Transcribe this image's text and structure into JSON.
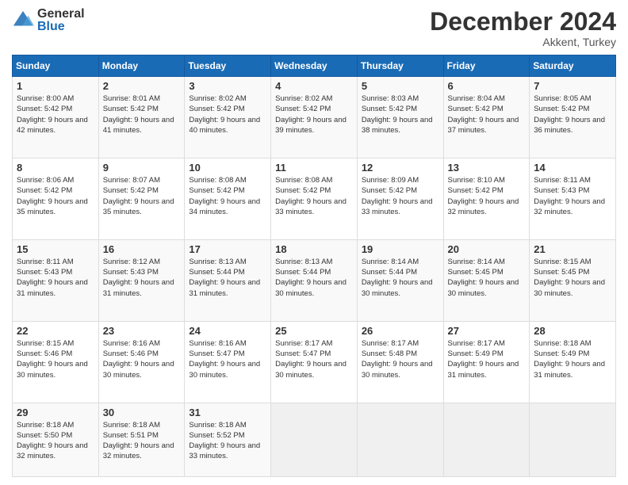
{
  "logo": {
    "general": "General",
    "blue": "Blue"
  },
  "title": "December 2024",
  "location": "Akkent, Turkey",
  "days_header": [
    "Sunday",
    "Monday",
    "Tuesday",
    "Wednesday",
    "Thursday",
    "Friday",
    "Saturday"
  ],
  "weeks": [
    [
      {
        "day": "1",
        "sunrise": "Sunrise: 8:00 AM",
        "sunset": "Sunset: 5:42 PM",
        "daylight": "Daylight: 9 hours and 42 minutes."
      },
      {
        "day": "2",
        "sunrise": "Sunrise: 8:01 AM",
        "sunset": "Sunset: 5:42 PM",
        "daylight": "Daylight: 9 hours and 41 minutes."
      },
      {
        "day": "3",
        "sunrise": "Sunrise: 8:02 AM",
        "sunset": "Sunset: 5:42 PM",
        "daylight": "Daylight: 9 hours and 40 minutes."
      },
      {
        "day": "4",
        "sunrise": "Sunrise: 8:02 AM",
        "sunset": "Sunset: 5:42 PM",
        "daylight": "Daylight: 9 hours and 39 minutes."
      },
      {
        "day": "5",
        "sunrise": "Sunrise: 8:03 AM",
        "sunset": "Sunset: 5:42 PM",
        "daylight": "Daylight: 9 hours and 38 minutes."
      },
      {
        "day": "6",
        "sunrise": "Sunrise: 8:04 AM",
        "sunset": "Sunset: 5:42 PM",
        "daylight": "Daylight: 9 hours and 37 minutes."
      },
      {
        "day": "7",
        "sunrise": "Sunrise: 8:05 AM",
        "sunset": "Sunset: 5:42 PM",
        "daylight": "Daylight: 9 hours and 36 minutes."
      }
    ],
    [
      {
        "day": "8",
        "sunrise": "Sunrise: 8:06 AM",
        "sunset": "Sunset: 5:42 PM",
        "daylight": "Daylight: 9 hours and 35 minutes."
      },
      {
        "day": "9",
        "sunrise": "Sunrise: 8:07 AM",
        "sunset": "Sunset: 5:42 PM",
        "daylight": "Daylight: 9 hours and 35 minutes."
      },
      {
        "day": "10",
        "sunrise": "Sunrise: 8:08 AM",
        "sunset": "Sunset: 5:42 PM",
        "daylight": "Daylight: 9 hours and 34 minutes."
      },
      {
        "day": "11",
        "sunrise": "Sunrise: 8:08 AM",
        "sunset": "Sunset: 5:42 PM",
        "daylight": "Daylight: 9 hours and 33 minutes."
      },
      {
        "day": "12",
        "sunrise": "Sunrise: 8:09 AM",
        "sunset": "Sunset: 5:42 PM",
        "daylight": "Daylight: 9 hours and 33 minutes."
      },
      {
        "day": "13",
        "sunrise": "Sunrise: 8:10 AM",
        "sunset": "Sunset: 5:42 PM",
        "daylight": "Daylight: 9 hours and 32 minutes."
      },
      {
        "day": "14",
        "sunrise": "Sunrise: 8:11 AM",
        "sunset": "Sunset: 5:43 PM",
        "daylight": "Daylight: 9 hours and 32 minutes."
      }
    ],
    [
      {
        "day": "15",
        "sunrise": "Sunrise: 8:11 AM",
        "sunset": "Sunset: 5:43 PM",
        "daylight": "Daylight: 9 hours and 31 minutes."
      },
      {
        "day": "16",
        "sunrise": "Sunrise: 8:12 AM",
        "sunset": "Sunset: 5:43 PM",
        "daylight": "Daylight: 9 hours and 31 minutes."
      },
      {
        "day": "17",
        "sunrise": "Sunrise: 8:13 AM",
        "sunset": "Sunset: 5:44 PM",
        "daylight": "Daylight: 9 hours and 31 minutes."
      },
      {
        "day": "18",
        "sunrise": "Sunrise: 8:13 AM",
        "sunset": "Sunset: 5:44 PM",
        "daylight": "Daylight: 9 hours and 30 minutes."
      },
      {
        "day": "19",
        "sunrise": "Sunrise: 8:14 AM",
        "sunset": "Sunset: 5:44 PM",
        "daylight": "Daylight: 9 hours and 30 minutes."
      },
      {
        "day": "20",
        "sunrise": "Sunrise: 8:14 AM",
        "sunset": "Sunset: 5:45 PM",
        "daylight": "Daylight: 9 hours and 30 minutes."
      },
      {
        "day": "21",
        "sunrise": "Sunrise: 8:15 AM",
        "sunset": "Sunset: 5:45 PM",
        "daylight": "Daylight: 9 hours and 30 minutes."
      }
    ],
    [
      {
        "day": "22",
        "sunrise": "Sunrise: 8:15 AM",
        "sunset": "Sunset: 5:46 PM",
        "daylight": "Daylight: 9 hours and 30 minutes."
      },
      {
        "day": "23",
        "sunrise": "Sunrise: 8:16 AM",
        "sunset": "Sunset: 5:46 PM",
        "daylight": "Daylight: 9 hours and 30 minutes."
      },
      {
        "day": "24",
        "sunrise": "Sunrise: 8:16 AM",
        "sunset": "Sunset: 5:47 PM",
        "daylight": "Daylight: 9 hours and 30 minutes."
      },
      {
        "day": "25",
        "sunrise": "Sunrise: 8:17 AM",
        "sunset": "Sunset: 5:47 PM",
        "daylight": "Daylight: 9 hours and 30 minutes."
      },
      {
        "day": "26",
        "sunrise": "Sunrise: 8:17 AM",
        "sunset": "Sunset: 5:48 PM",
        "daylight": "Daylight: 9 hours and 30 minutes."
      },
      {
        "day": "27",
        "sunrise": "Sunrise: 8:17 AM",
        "sunset": "Sunset: 5:49 PM",
        "daylight": "Daylight: 9 hours and 31 minutes."
      },
      {
        "day": "28",
        "sunrise": "Sunrise: 8:18 AM",
        "sunset": "Sunset: 5:49 PM",
        "daylight": "Daylight: 9 hours and 31 minutes."
      }
    ],
    [
      {
        "day": "29",
        "sunrise": "Sunrise: 8:18 AM",
        "sunset": "Sunset: 5:50 PM",
        "daylight": "Daylight: 9 hours and 32 minutes."
      },
      {
        "day": "30",
        "sunrise": "Sunrise: 8:18 AM",
        "sunset": "Sunset: 5:51 PM",
        "daylight": "Daylight: 9 hours and 32 minutes."
      },
      {
        "day": "31",
        "sunrise": "Sunrise: 8:18 AM",
        "sunset": "Sunset: 5:52 PM",
        "daylight": "Daylight: 9 hours and 33 minutes."
      },
      null,
      null,
      null,
      null
    ]
  ]
}
